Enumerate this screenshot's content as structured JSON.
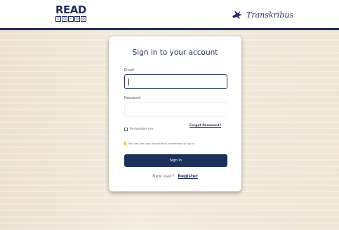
{
  "header": {
    "read_logo": {
      "word": "READ",
      "letters": [
        "c",
        "o",
        "-",
        "o",
        "p"
      ]
    },
    "transkribus_logo": {
      "icon": "bird-icon",
      "word": "Transkribus"
    }
  },
  "login": {
    "title": "Sign in to your account",
    "email_label": "Email",
    "email_value": "",
    "password_label": "Password",
    "password_value": "",
    "forgot_password": "Forgot Password?",
    "remember_me": "Remember me",
    "remember_checked": false,
    "info_text": "You can use your Transkribus credentials to log in",
    "info_icon": "info-bar-icon",
    "signin_label": "Sign In",
    "new_user_text": "New user?",
    "register_label": "Register"
  },
  "colors": {
    "brand_navy": "#1e2f5a",
    "background_beige": "#f0e7da",
    "info_accent": "#f2c230"
  }
}
